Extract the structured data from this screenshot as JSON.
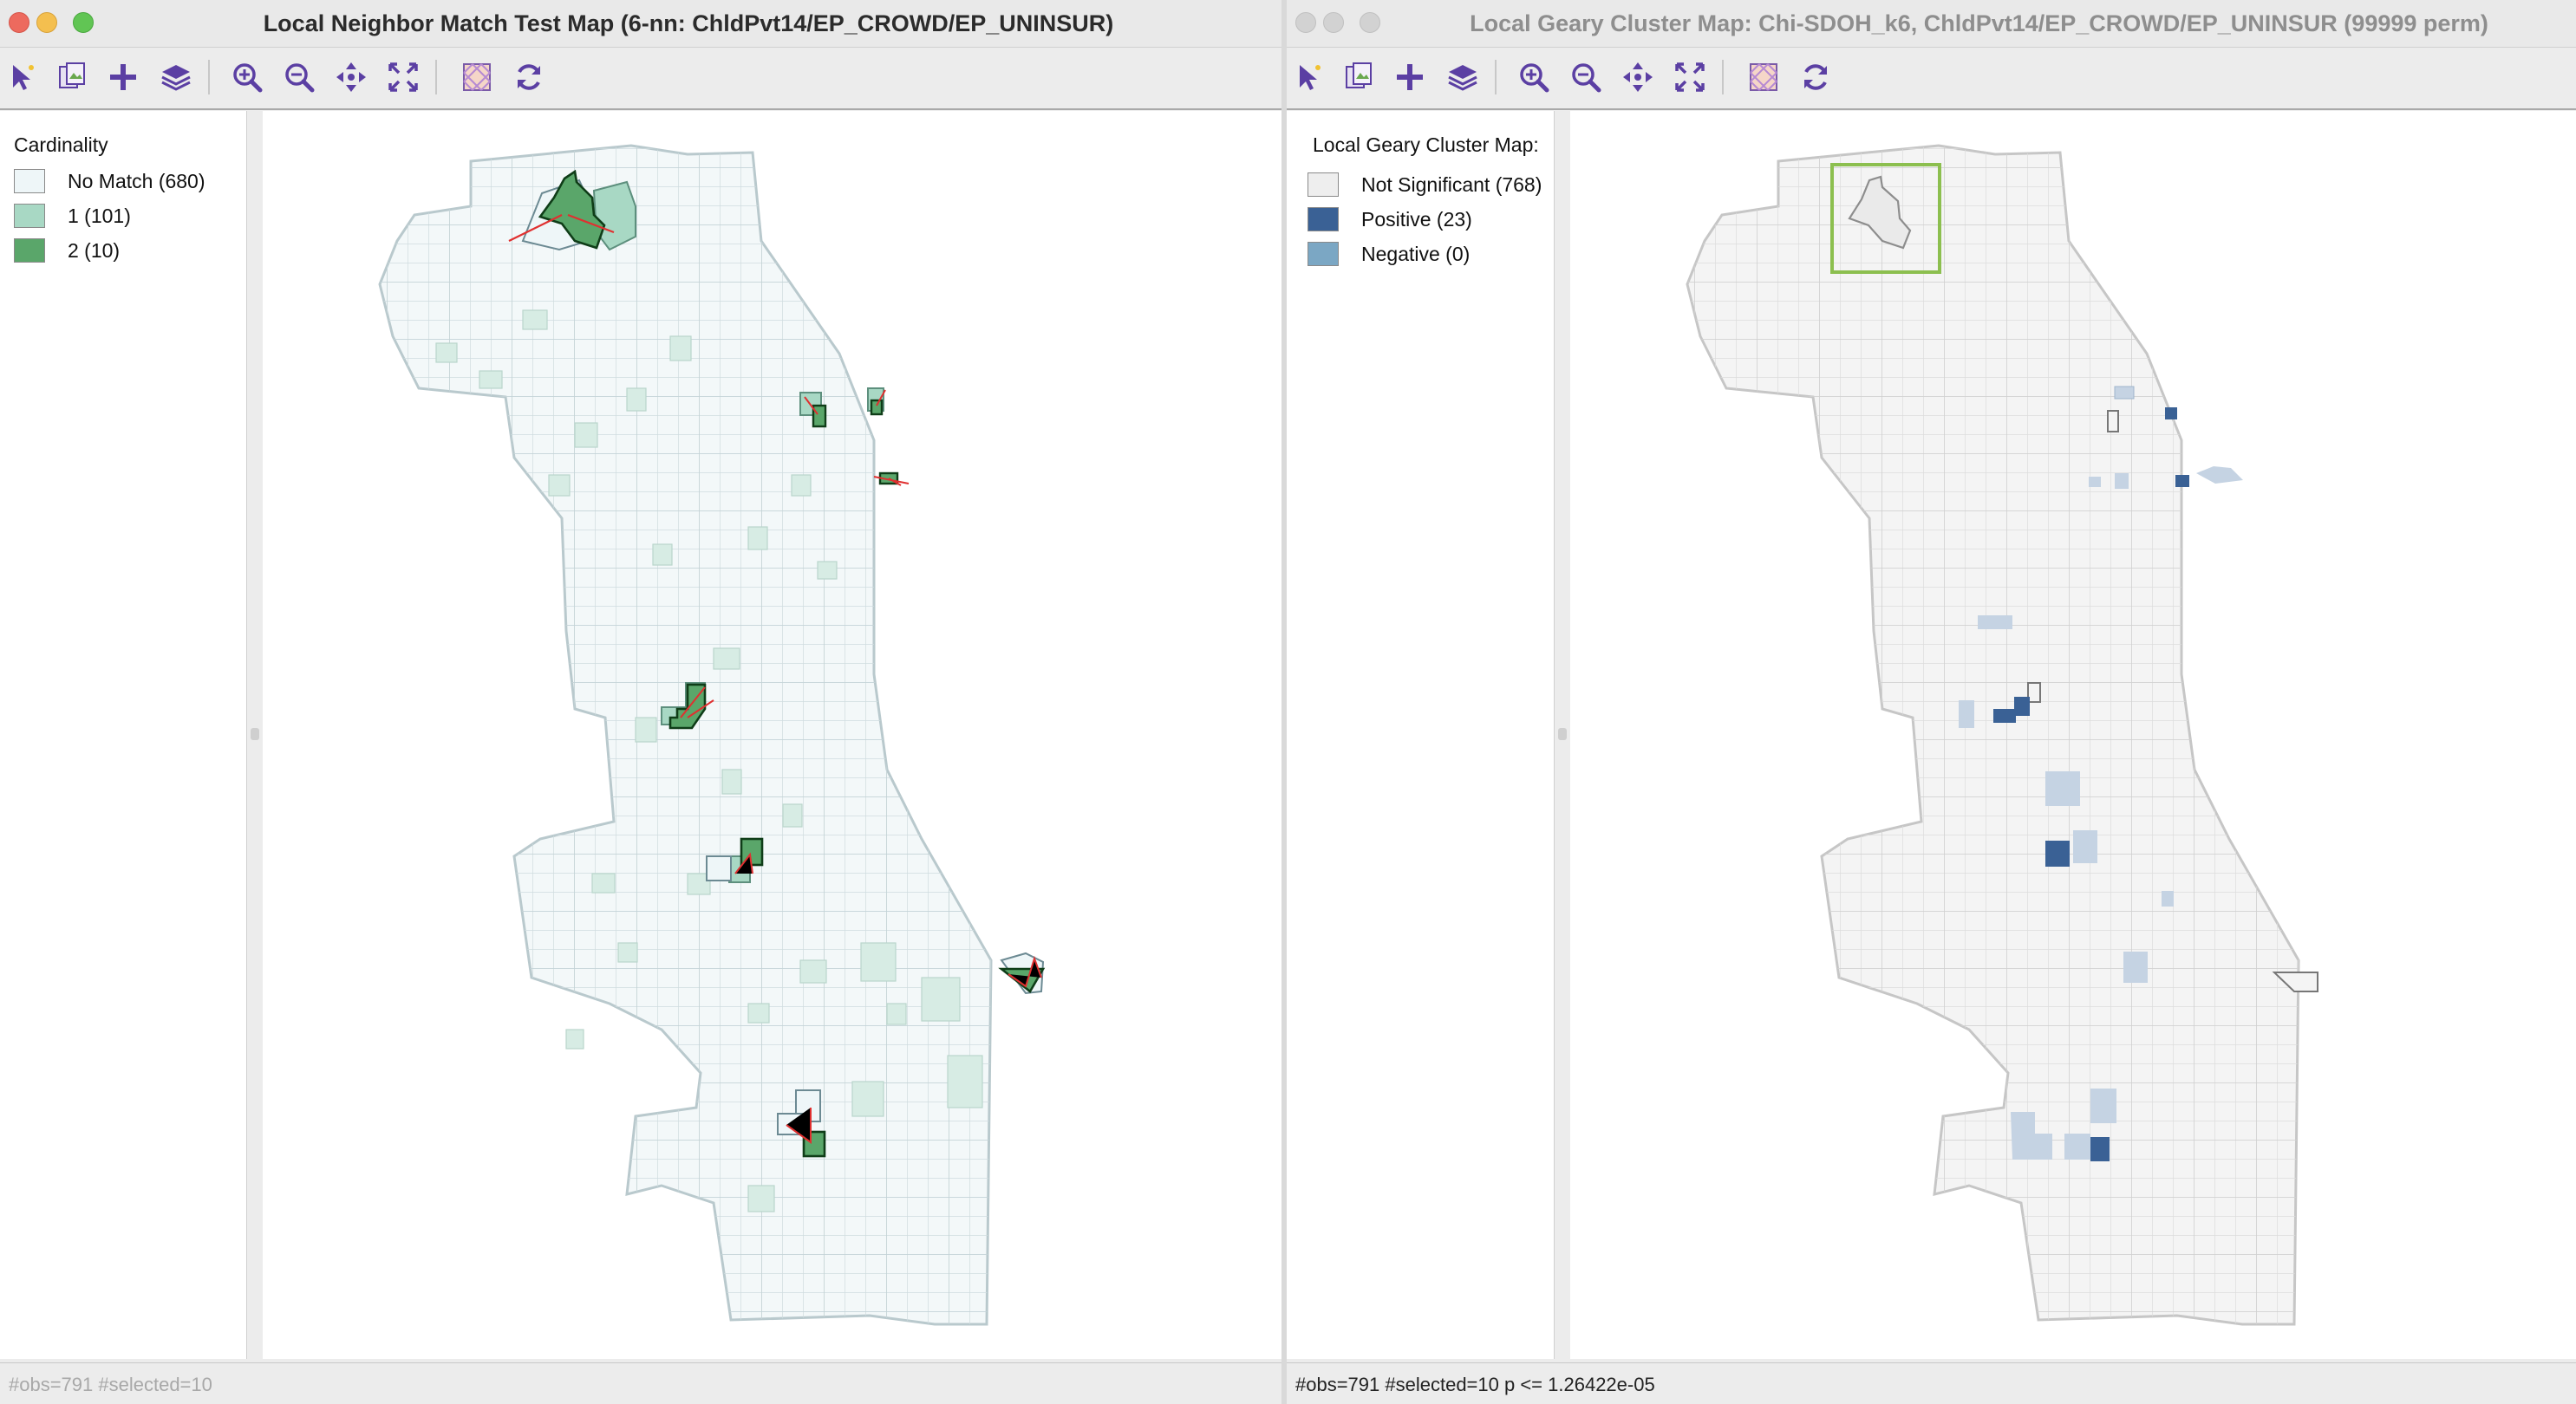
{
  "left_window": {
    "title": "Local Neighbor Match Test Map (6-nn: ChldPvt14/EP_CROWD/EP_UNINSUR)",
    "legend": {
      "title": "Cardinality",
      "items": [
        {
          "label": "No Match (680)",
          "color": "#eef6f8"
        },
        {
          "label": "1 (101)",
          "color": "#a8d8c4"
        },
        {
          "label": "2 (10)",
          "color": "#5aa66a"
        }
      ]
    },
    "status": "#obs=791 #selected=10"
  },
  "right_window": {
    "title": "Local Geary Cluster Map: Chi-SDOH_k6, ChldPvt14/EP_CROWD/EP_UNINSUR (99999 perm)",
    "legend": {
      "title": "Local Geary Cluster Map:",
      "items": [
        {
          "label": "Not Significant (768)",
          "color": "#eeeeee"
        },
        {
          "label": "Positive (23)",
          "color": "#3a6195"
        },
        {
          "label": "Negative (0)",
          "color": "#7ba7c4"
        }
      ]
    },
    "status": "#obs=791 #selected=10   p <= 1.26422e-05"
  },
  "toolbar": {
    "icons": [
      "select-pointer-icon",
      "copy-image-icon",
      "add-layer-icon",
      "layers-icon",
      "zoom-in-icon",
      "zoom-out-icon",
      "pan-icon",
      "fit-extent-icon",
      "basemap-icon",
      "refresh-icon"
    ]
  },
  "colors": {
    "icon_purple": "#5b3fa3",
    "selection_outline": "#8cbf4f",
    "link_red": "#e03030",
    "map_fill_left": "#f3f8f9",
    "map_fill_right": "#f4f4f4",
    "tract_line": "#cfd9dc"
  }
}
